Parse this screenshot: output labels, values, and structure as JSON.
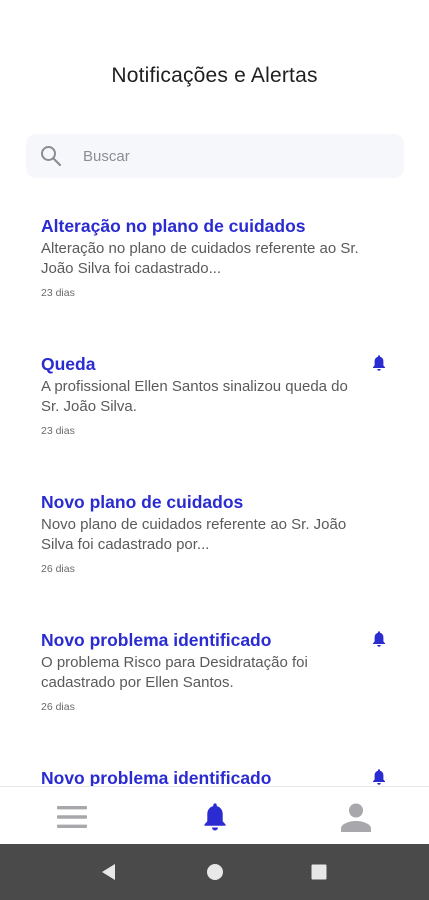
{
  "header": {
    "title": "Notificações e Alertas"
  },
  "search": {
    "placeholder": "Buscar"
  },
  "notifications": [
    {
      "title": "Alteração no plano de cuidados",
      "description": "Alteração no plano de cuidados referente ao Sr. João Silva foi cadastrado...",
      "time": "23 dias",
      "alert": false
    },
    {
      "title": "Queda",
      "description": "A profissional Ellen Santos sinalizou queda do Sr. João Silva.",
      "time": "23 dias",
      "alert": true
    },
    {
      "title": "Novo plano de cuidados",
      "description": "Novo plano de cuidados referente ao Sr. João Silva foi cadastrado por...",
      "time": "26 dias",
      "alert": false
    },
    {
      "title": "Novo problema identificado",
      "description": "O problema Risco para Desidratação foi cadastrado por Ellen Santos.",
      "time": "26 dias",
      "alert": true
    },
    {
      "title": "Novo problema identificado",
      "description": "",
      "time": "",
      "alert": true
    }
  ],
  "bottom_nav": {
    "items": [
      {
        "icon": "menu-icon",
        "active": false
      },
      {
        "icon": "bell-icon",
        "active": true
      },
      {
        "icon": "user-icon",
        "active": false
      }
    ]
  },
  "colors": {
    "accent": "#2a2bd1",
    "inactive_icon": "#a8a8ac",
    "system_bar": "#4a4a4a"
  }
}
